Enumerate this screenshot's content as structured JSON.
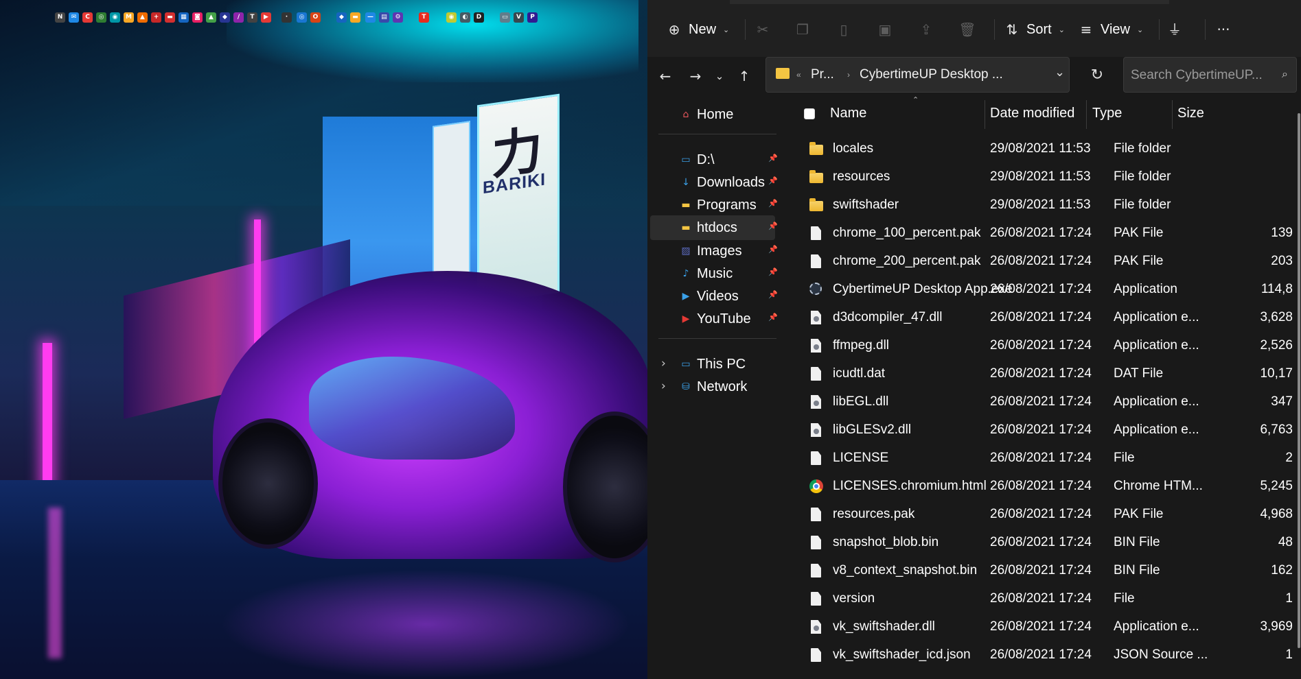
{
  "tray_icons": [
    {
      "name": "notion-icon",
      "color": "#444444",
      "glyph": "N"
    },
    {
      "name": "mail-icon",
      "color": "#1e88e5",
      "glyph": "✉"
    },
    {
      "name": "chrome-app-icon",
      "color": "#e53935",
      "glyph": "C"
    },
    {
      "name": "whatsapp-icon",
      "color": "#2e7d32",
      "glyph": "◎"
    },
    {
      "name": "webcam-icon",
      "color": "#0097a7",
      "glyph": "◉"
    },
    {
      "name": "notes-icon",
      "color": "#f9a825",
      "glyph": "M"
    },
    {
      "name": "drive-warning-icon",
      "color": "#ef6c00",
      "glyph": "▲"
    },
    {
      "name": "plus-icon",
      "color": "#c62828",
      "glyph": "+"
    },
    {
      "name": "red-app-icon",
      "color": "#d32f2f",
      "glyph": "▬"
    },
    {
      "name": "trello-icon",
      "color": "#1565c0",
      "glyph": "▦"
    },
    {
      "name": "cast-icon",
      "color": "#e91e63",
      "glyph": "◙"
    },
    {
      "name": "google-drive-icon",
      "color": "#43a047",
      "glyph": "▲"
    },
    {
      "name": "shield-icon",
      "color": "#283593",
      "glyph": "◆"
    },
    {
      "name": "pen-icon",
      "color": "#8e24aa",
      "glyph": "/"
    },
    {
      "name": "text-icon",
      "color": "#424242",
      "glyph": "T"
    },
    {
      "name": "youtube-icon",
      "color": "#e53935",
      "glyph": "▶"
    },
    {
      "name": "dots-icon",
      "color": "#333333",
      "glyph": "·"
    },
    {
      "name": "translate-icon",
      "color": "#1976d2",
      "glyph": "◎"
    },
    {
      "name": "office-icon",
      "color": "#d84315",
      "glyph": "O"
    },
    {
      "name": "bitwarden-icon",
      "color": "#1565c0",
      "glyph": "◆"
    },
    {
      "name": "folder-app-icon",
      "color": "#f9a825",
      "glyph": "▬"
    },
    {
      "name": "minus-app-icon",
      "color": "#1e88e5",
      "glyph": "—"
    },
    {
      "name": "calendar-app-icon",
      "color": "#3949ab",
      "glyph": "▤"
    },
    {
      "name": "settings-app-icon",
      "color": "#5e35b1",
      "glyph": "⚙"
    },
    {
      "name": "ted-icon",
      "color": "#e62b1e",
      "glyph": "T"
    },
    {
      "name": "avatar-app-icon",
      "color": "#c0ca33",
      "glyph": "◉"
    },
    {
      "name": "camera-app-icon",
      "color": "#455a64",
      "glyph": "◐"
    },
    {
      "name": "dictionary-app-icon",
      "color": "#212121",
      "glyph": "D"
    },
    {
      "name": "card-app-icon",
      "color": "#607d8b",
      "glyph": "▭"
    },
    {
      "name": "vn-app-icon",
      "color": "#37474f",
      "glyph": "V"
    },
    {
      "name": "pr-app-icon",
      "color": "#311b92",
      "glyph": "P"
    }
  ],
  "wallpaper": {
    "sign_kanji": "力",
    "sign_word": "BARIKI"
  },
  "toolbar": {
    "new_label": "New",
    "sort_label": "Sort",
    "view_label": "View",
    "more_label": "···"
  },
  "address": {
    "crumb_parent": "Pr...",
    "crumb_current": "CybertimeUP Desktop ...",
    "search_placeholder": "Search CybertimeUP..."
  },
  "sidebar": {
    "items": [
      {
        "label": "Home",
        "icon": "home-icon",
        "color": "#e8565c",
        "pinned": false
      },
      {
        "label": "D:\\",
        "icon": "drive-icon",
        "color": "#3aa0e8",
        "pinned": true
      },
      {
        "label": "Downloads",
        "icon": "download-icon",
        "color": "#3aa0e8",
        "pinned": true
      },
      {
        "label": "Programs",
        "icon": "folder-icon",
        "color": "#f4c542",
        "pinned": true
      },
      {
        "label": "htdocs",
        "icon": "folder-icon",
        "color": "#f4c542",
        "pinned": true
      },
      {
        "label": "Images",
        "icon": "pictures-icon",
        "color": "#5c6bc0",
        "pinned": true
      },
      {
        "label": "Music",
        "icon": "music-icon",
        "color": "#3aa0e8",
        "pinned": true
      },
      {
        "label": "Videos",
        "icon": "videos-icon",
        "color": "#3aa0e8",
        "pinned": true
      },
      {
        "label": "YouTube",
        "icon": "youtube-folder-icon",
        "color": "#e53935",
        "pinned": true
      },
      {
        "label": "This PC",
        "icon": "computer-icon",
        "color": "#3aa0e8",
        "pinned": false
      },
      {
        "label": "Network",
        "icon": "network-icon",
        "color": "#3aa0e8",
        "pinned": false
      }
    ]
  },
  "columns": {
    "name": "Name",
    "date": "Date modified",
    "type": "Type",
    "size": "Size"
  },
  "files": [
    {
      "name": "locales",
      "date": "29/08/2021 11:53",
      "type": "File folder",
      "size": "",
      "kind": "folder"
    },
    {
      "name": "resources",
      "date": "29/08/2021 11:53",
      "type": "File folder",
      "size": "",
      "kind": "folder"
    },
    {
      "name": "swiftshader",
      "date": "29/08/2021 11:53",
      "type": "File folder",
      "size": "",
      "kind": "folder"
    },
    {
      "name": "chrome_100_percent.pak",
      "date": "26/08/2021 17:24",
      "type": "PAK File",
      "size": "139",
      "kind": "file"
    },
    {
      "name": "chrome_200_percent.pak",
      "date": "26/08/2021 17:24",
      "type": "PAK File",
      "size": "203",
      "kind": "file"
    },
    {
      "name": "CybertimeUP Desktop App.exe",
      "date": "26/08/2021 17:24",
      "type": "Application",
      "size": "114,8",
      "kind": "exe"
    },
    {
      "name": "d3dcompiler_47.dll",
      "date": "26/08/2021 17:24",
      "type": "Application e...",
      "size": "3,628",
      "kind": "dll"
    },
    {
      "name": "ffmpeg.dll",
      "date": "26/08/2021 17:24",
      "type": "Application e...",
      "size": "2,526",
      "kind": "dll"
    },
    {
      "name": "icudtl.dat",
      "date": "26/08/2021 17:24",
      "type": "DAT File",
      "size": "10,17",
      "kind": "file"
    },
    {
      "name": "libEGL.dll",
      "date": "26/08/2021 17:24",
      "type": "Application e...",
      "size": "347",
      "kind": "dll"
    },
    {
      "name": "libGLESv2.dll",
      "date": "26/08/2021 17:24",
      "type": "Application e...",
      "size": "6,763",
      "kind": "dll"
    },
    {
      "name": "LICENSE",
      "date": "26/08/2021 17:24",
      "type": "File",
      "size": "2",
      "kind": "file"
    },
    {
      "name": "LICENSES.chromium.html",
      "date": "26/08/2021 17:24",
      "type": "Chrome HTM...",
      "size": "5,245",
      "kind": "chrome"
    },
    {
      "name": "resources.pak",
      "date": "26/08/2021 17:24",
      "type": "PAK File",
      "size": "4,968",
      "kind": "file"
    },
    {
      "name": "snapshot_blob.bin",
      "date": "26/08/2021 17:24",
      "type": "BIN File",
      "size": "48",
      "kind": "file"
    },
    {
      "name": "v8_context_snapshot.bin",
      "date": "26/08/2021 17:24",
      "type": "BIN File",
      "size": "162",
      "kind": "file"
    },
    {
      "name": "version",
      "date": "26/08/2021 17:24",
      "type": "File",
      "size": "1",
      "kind": "file"
    },
    {
      "name": "vk_swiftshader.dll",
      "date": "26/08/2021 17:24",
      "type": "Application e...",
      "size": "3,969",
      "kind": "dll"
    },
    {
      "name": "vk_swiftshader_icd.json",
      "date": "26/08/2021 17:24",
      "type": "JSON Source ...",
      "size": "1",
      "kind": "file"
    }
  ],
  "selected_sidebar": "htdocs"
}
